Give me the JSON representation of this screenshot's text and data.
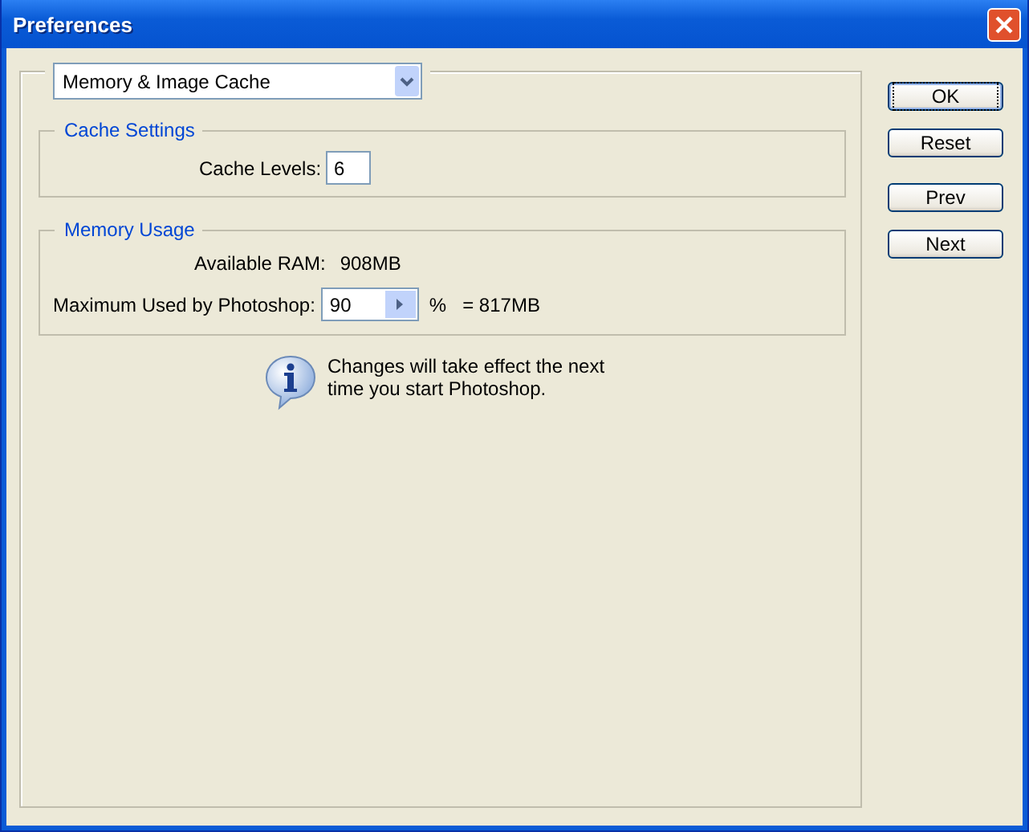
{
  "window": {
    "title": "Preferences"
  },
  "section_dropdown": {
    "value": "Memory & Image Cache"
  },
  "cache_settings": {
    "title": "Cache Settings",
    "cache_levels": {
      "label": "Cache Levels:",
      "value": "6"
    }
  },
  "memory_usage": {
    "title": "Memory Usage",
    "available_ram": {
      "label": "Available RAM:",
      "value": "908MB"
    },
    "maximum_used": {
      "label": "Maximum Used by Photoshop:",
      "value": "90",
      "unit": "%",
      "result": "= 817MB"
    }
  },
  "info": "Changes will take effect the next time you start Photoshop.",
  "buttons": [
    {
      "label": "OK",
      "default": true
    },
    {
      "label": "Reset",
      "default": false
    },
    {
      "label": "Prev",
      "default": false
    },
    {
      "label": "Next",
      "default": false
    }
  ]
}
